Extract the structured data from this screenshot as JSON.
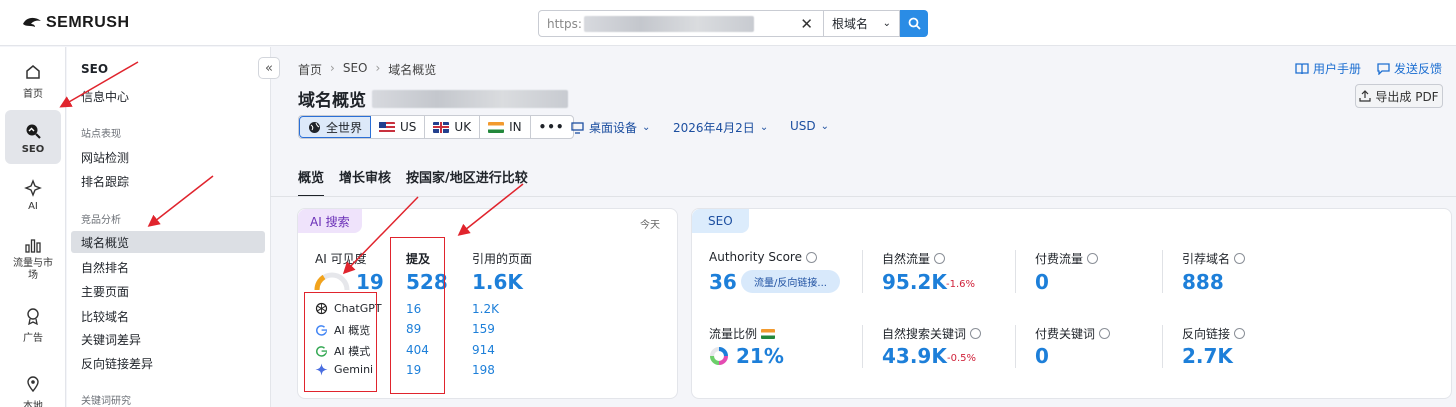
{
  "topbar": {
    "logo": "SEMRUSH",
    "search_prefix": "https:",
    "scope": "根域名"
  },
  "rail": [
    {
      "label": "首页",
      "icon": "home-icon"
    },
    {
      "label": "SEO",
      "icon": "seo-icon"
    },
    {
      "label": "AI",
      "icon": "ai-icon"
    },
    {
      "label": "流量与市场",
      "icon": "traffic-icon"
    },
    {
      "label": "广告",
      "icon": "ads-icon"
    },
    {
      "label": "本地",
      "icon": "location-icon"
    }
  ],
  "sidebar": {
    "title": "SEO",
    "info_center": "信息中心",
    "group1": "站点表现",
    "site_audit": "网站检测",
    "rank_tracking": "排名跟踪",
    "group2": "竞品分析",
    "items": [
      "域名概览",
      "自然排名",
      "主要页面",
      "比较域名",
      "关键词差异",
      "反向链接差异"
    ],
    "group3": "关键词研究"
  },
  "breadcrumb": [
    "首页",
    "SEO",
    "域名概览"
  ],
  "page_title": "域名概览",
  "links": {
    "manual": "用户手册",
    "feedback": "发送反馈"
  },
  "export": "导出成 PDF",
  "regions": [
    "全世界",
    "US",
    "UK",
    "IN"
  ],
  "device": "桌面设备",
  "date": "2026年4月2日",
  "currency": "USD",
  "tabs": [
    "概览",
    "增长审核",
    "按国家/地区进行比较"
  ],
  "ai_card": {
    "badge": "AI 搜索",
    "today": "今天",
    "visibility_label": "AI 可见度",
    "visibility_value": "19",
    "mentions_label": "提及",
    "mentions_value": "528",
    "cited_label": "引用的页面",
    "cited_value": "1.6K",
    "engines": [
      {
        "name": "ChatGPT",
        "mentions": "16",
        "cited": "1.2K"
      },
      {
        "name": "AI 概览",
        "mentions": "89",
        "cited": "159"
      },
      {
        "name": "AI 模式",
        "mentions": "404",
        "cited": "914"
      },
      {
        "name": "Gemini",
        "mentions": "19",
        "cited": "198"
      }
    ]
  },
  "seo_card": {
    "badge": "SEO",
    "authority_label": "Authority Score",
    "authority_value": "36",
    "authority_pill": "流量/反向链接...",
    "organic_label": "自然流量",
    "organic_value": "95.2K",
    "organic_delta": "-1.6%",
    "paid_label": "付费流量",
    "paid_value": "0",
    "refdomains_label": "引荐域名",
    "refdomains_value": "888",
    "share_label": "流量比例",
    "share_value": "21%",
    "org_kw_label": "自然搜索关键词",
    "org_kw_value": "43.9K",
    "org_kw_delta": "-0.5%",
    "paid_kw_label": "付费关键词",
    "paid_kw_value": "0",
    "backlinks_label": "反向链接",
    "backlinks_value": "2.7K"
  },
  "colors": {
    "accent": "#1d7fd9",
    "annotation": "#e0242d",
    "negative": "#d0223a"
  }
}
